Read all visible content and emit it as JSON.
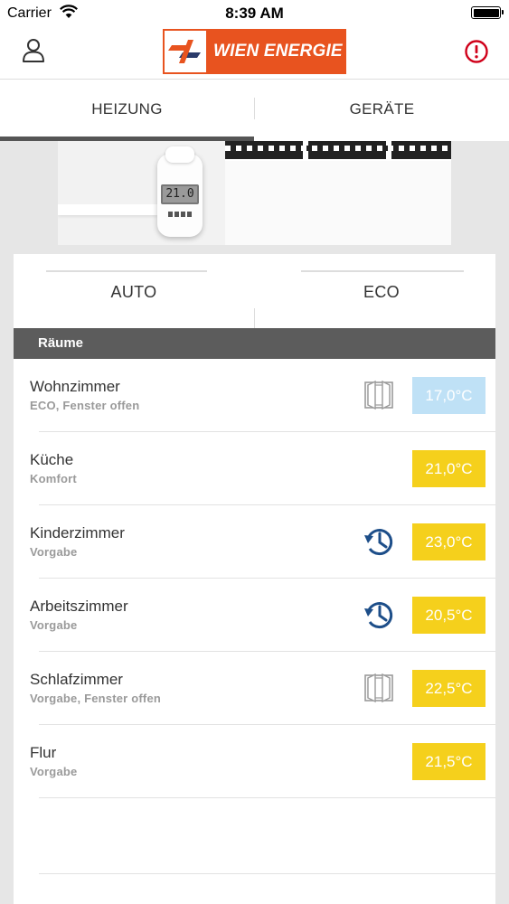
{
  "status_bar": {
    "carrier": "Carrier",
    "time": "8:39 AM"
  },
  "header": {
    "logo_text": "WIEN ENERGIE"
  },
  "tabs": [
    {
      "label": "HEIZUNG",
      "active": true
    },
    {
      "label": "GERÄTE",
      "active": false
    }
  ],
  "hero": {
    "thermostat_display": "21.0"
  },
  "modes": {
    "auto_label": "AUTO",
    "eco_label": "ECO"
  },
  "rooms_section": {
    "title": "Räume"
  },
  "rooms": [
    {
      "name": "Wohnzimmer",
      "status": "ECO, Fenster offen",
      "icon": "window-icon",
      "temperature": "17,0°C",
      "tone": "cool"
    },
    {
      "name": "Küche",
      "status": "Komfort",
      "icon": "",
      "temperature": "21,0°C",
      "tone": "warm"
    },
    {
      "name": "Kinderzimmer",
      "status": "Vorgabe",
      "icon": "schedule-clock-icon",
      "temperature": "23,0°C",
      "tone": "warm"
    },
    {
      "name": "Arbeitszimmer",
      "status": "Vorgabe",
      "icon": "schedule-clock-icon",
      "temperature": "20,5°C",
      "tone": "warm"
    },
    {
      "name": "Schlafzimmer",
      "status": "Vorgabe, Fenster offen",
      "icon": "window-icon",
      "temperature": "22,5°C",
      "tone": "warm"
    },
    {
      "name": "Flur",
      "status": "Vorgabe",
      "icon": "",
      "temperature": "21,5°C",
      "tone": "warm"
    }
  ],
  "colors": {
    "brand": "#e8531f",
    "warm_temp": "#f5d01c",
    "cool_temp": "#bfe1f6",
    "alert": "#d0021b",
    "clock_icon": "#1d4e89",
    "section_header": "#5c5c5c"
  }
}
